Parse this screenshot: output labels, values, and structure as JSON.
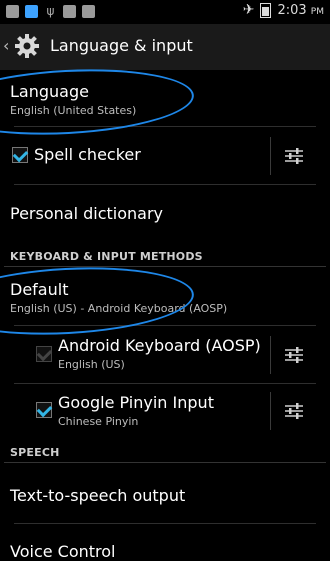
{
  "statusbar": {
    "time": "2:03",
    "ampm": "PM"
  },
  "actionbar": {
    "back_glyph": "‹",
    "title": "Language & input"
  },
  "language": {
    "title": "Language",
    "summary": "English (United States)"
  },
  "spell": {
    "label": "Spell checker",
    "checked": true
  },
  "personal_dictionary": {
    "label": "Personal dictionary"
  },
  "keyboard_section": {
    "header": "KEYBOARD & INPUT METHODS"
  },
  "default_method": {
    "title": "Default",
    "summary": "English (US) - Android Keyboard (AOSP)"
  },
  "keyboards": [
    {
      "title": "Android Keyboard (AOSP)",
      "summary": "English (US)",
      "checked": true,
      "enabled": false
    },
    {
      "title": "Google Pinyin Input",
      "summary": "Chinese Pinyin",
      "checked": true,
      "enabled": true
    }
  ],
  "speech_section": {
    "header": "SPEECH"
  },
  "tts": {
    "label": "Text-to-speech output"
  },
  "voice": {
    "label": "Voice Control"
  },
  "colors": {
    "accent": "#33b5e5",
    "annotation": "#1e87e8"
  }
}
